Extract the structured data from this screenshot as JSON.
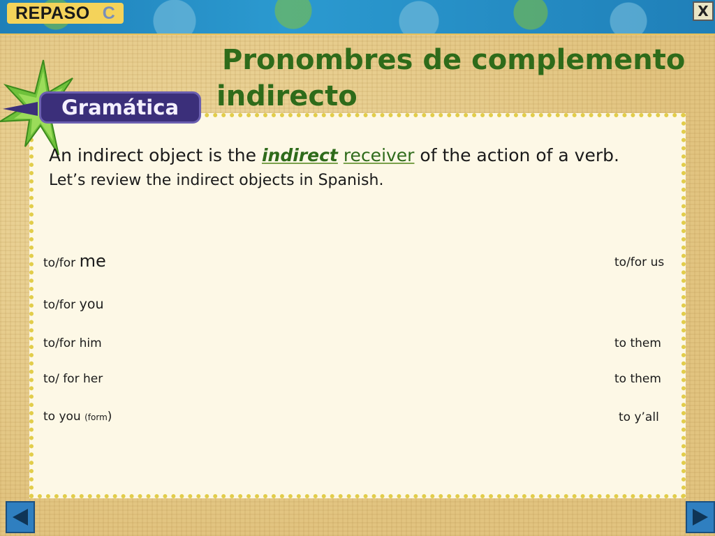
{
  "header": {
    "section": "REPASO",
    "letter": "C",
    "close_label": "X"
  },
  "title": "Pronombres de complemento indirecto",
  "badge": "Gramática",
  "intro": {
    "part1": "An indirect object is the ",
    "highlight1": "indirect",
    "space": " ",
    "highlight2": "receiver",
    "part2": " of the action of a verb.",
    "line2": "Let’s review the indirect objects in Spanish."
  },
  "pronouns": {
    "left": {
      "me_prefix": "to/for ",
      "me_word": "me",
      "you_prefix": "to/for ",
      "you_word": "you",
      "him": "to/for him",
      "her": "to/ for her",
      "form_prefix": "to you ",
      "form_note": "(form",
      "form_close": ")"
    },
    "right": {
      "us": "to/for us",
      "them1": "to them",
      "them2": "to them",
      "yall": "to y’all"
    }
  },
  "nav": {
    "prev_icon": "left-arrow-icon",
    "next_icon": "right-arrow-icon"
  },
  "colors": {
    "title_green": "#2e6b1a",
    "header_blue": "#1f7fb8",
    "badge_purple": "#3b2f7a",
    "star_green": "#6fc13b",
    "panel_bg": "#fdf8e6"
  }
}
